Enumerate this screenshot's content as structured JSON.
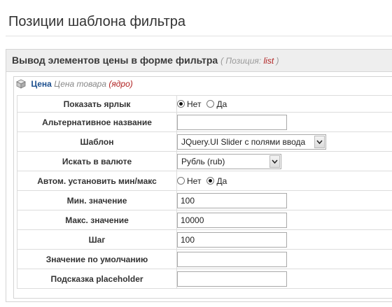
{
  "page_title": "Позиции шаблона фильтра",
  "section": {
    "title": "Вывод элементов цены в форме фильтра",
    "position_label": "( Позиция:",
    "position_value": "list",
    "position_close": ")"
  },
  "field": {
    "name": "Цена",
    "description": "Цена товара",
    "core": "(ядро)"
  },
  "icons": {
    "field": "cube-icon",
    "select_arrow": "chevron-down-icon"
  },
  "form": {
    "show_label": {
      "label": "Показать ярлык",
      "options": [
        "Нет",
        "Да"
      ],
      "selected": "Нет"
    },
    "alt_name": {
      "label": "Альтернативное название",
      "value": ""
    },
    "template": {
      "label": "Шаблон",
      "value": "JQuery.UI Slider с полями ввода"
    },
    "currency": {
      "label": "Искать в валюте",
      "value": "Рубль (rub)"
    },
    "auto_minmax": {
      "label": "Автом. установить мин/макс",
      "options": [
        "Нет",
        "Да"
      ],
      "selected": "Да"
    },
    "min_value": {
      "label": "Мин. значение",
      "value": "100"
    },
    "max_value": {
      "label": "Макс. значение",
      "value": "10000"
    },
    "step": {
      "label": "Шаг",
      "value": "100"
    },
    "default_value": {
      "label": "Значение по умолчанию",
      "value": ""
    },
    "placeholder": {
      "label": "Подсказка placeholder",
      "value": ""
    }
  }
}
